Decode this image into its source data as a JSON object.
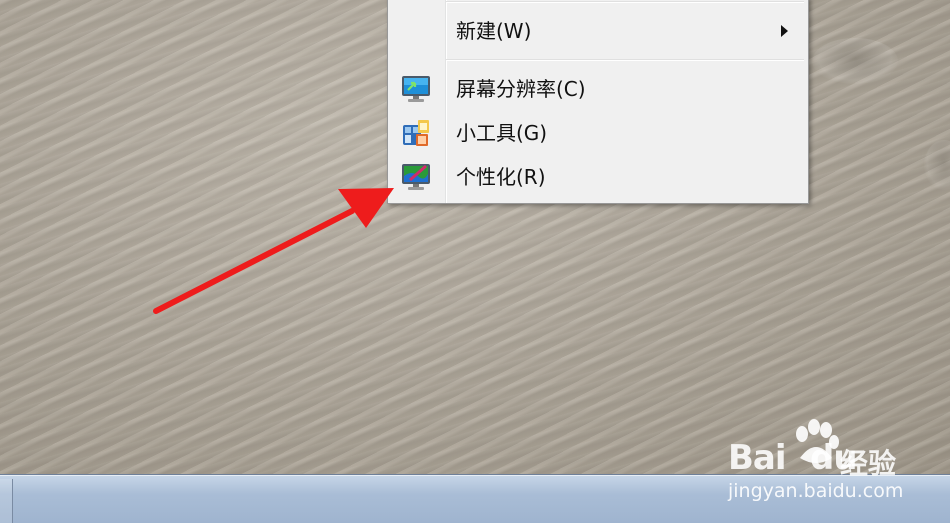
{
  "context_menu": {
    "items": [
      {
        "label": "新建(W)",
        "icon": "none",
        "has_submenu": true
      },
      {
        "label": "屏幕分辨率(C)",
        "icon": "monitor-resolution-icon"
      },
      {
        "label": "小工具(G)",
        "icon": "gadgets-icon"
      },
      {
        "label": "个性化(R)",
        "icon": "personalize-icon"
      }
    ]
  },
  "annotation": {
    "color": "#ee1c1c",
    "points_to": "个性化(R)"
  },
  "watermark": {
    "brand_left": "Bai",
    "brand_right": "du",
    "brand_cn": "经验",
    "url": "jingyan.baidu.com"
  },
  "colors": {
    "menu_background": "#f0f0f0",
    "taskbar": "#a9bdd6",
    "desktop_sand": "#b1a99c"
  }
}
